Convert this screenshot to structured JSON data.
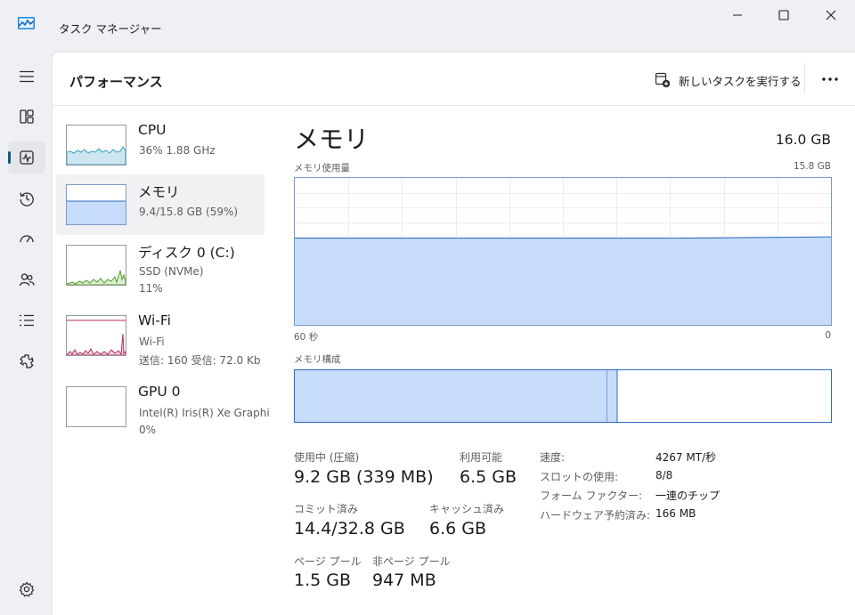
{
  "window": {
    "title": "タスク マネージャー",
    "controls": [
      "minimize-icon",
      "maximize-icon",
      "close-icon"
    ]
  },
  "nav": {
    "items": [
      {
        "icon": "hamburger-menu-icon"
      },
      {
        "icon": "processes-icon"
      },
      {
        "icon": "performance-icon",
        "active": true
      },
      {
        "icon": "app-history-icon"
      },
      {
        "icon": "startup-apps-icon"
      },
      {
        "icon": "users-icon"
      },
      {
        "icon": "details-icon"
      },
      {
        "icon": "services-icon"
      },
      {
        "icon": "settings-icon"
      }
    ]
  },
  "header": {
    "title": "パフォーマンス",
    "run_task_label": "新しいタスクを実行する",
    "run_task_icon": "new-task-icon",
    "more_icon": "more-options-icon"
  },
  "resources": [
    {
      "name": "CPU",
      "lines": [
        "36%  1.88 GHz"
      ]
    },
    {
      "name": "メモリ",
      "lines": [
        "9.4/15.8 GB (59%)"
      ],
      "selected": true
    },
    {
      "name": "ディスク 0 (C:)",
      "lines": [
        "SSD (NVMe)",
        "11%"
      ]
    },
    {
      "name": "Wi-Fi",
      "lines": [
        "Wi-Fi",
        "送信: 160  受信: 72.0 Kb"
      ]
    },
    {
      "name": "GPU 0",
      "lines": [
        "Intel(R) Iris(R) Xe Graphi",
        "0%"
      ]
    }
  ],
  "detail": {
    "title": "メモリ",
    "total": "16.0 GB",
    "usage_label": "メモリ使用量",
    "usage_max": "15.8 GB",
    "axis_left": "60 秒",
    "axis_right": "0",
    "usage_level": 0.59,
    "composition_label": "メモリ構成",
    "composition": {
      "in_use": 9.2,
      "modified": 0.3,
      "total": 15.8
    },
    "stats": {
      "in_use_label": "使用中 (圧縮)",
      "in_use_value": "9.2 GB (339 MB)",
      "available_label": "利用可能",
      "available_value": "6.5 GB",
      "committed_label": "コミット済み",
      "committed_value": "14.4/32.8 GB",
      "cached_label": "キャッシュ済み",
      "cached_value": "6.6 GB",
      "paged_label": "ページ プール",
      "paged_value": "1.5 GB",
      "nonpaged_label": "非ページ プール",
      "nonpaged_value": "947 MB"
    },
    "specs": [
      {
        "key": "速度:",
        "value": "4267 MT/秒"
      },
      {
        "key": "スロットの使用:",
        "value": "8/8"
      },
      {
        "key": "フォーム ファクター:",
        "value": "一連のチップ"
      },
      {
        "key": "ハードウェア予約済み:",
        "value": "166 MB"
      }
    ]
  },
  "colors": {
    "memory_fill": "#c6dcfa",
    "memory_line": "#2d68c4",
    "cpu": "#33a3c4",
    "disk": "#4d9b24",
    "wifi": "#b52f62",
    "accent": "#0d5d79"
  }
}
